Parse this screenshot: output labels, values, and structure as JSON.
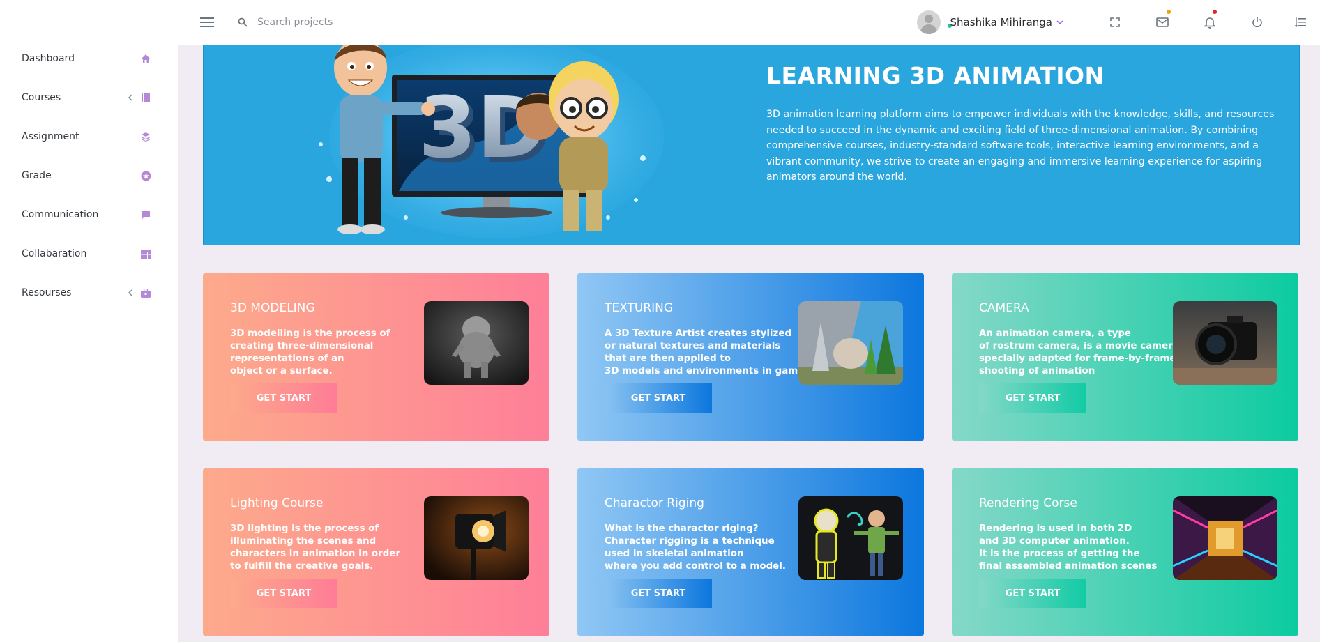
{
  "header": {
    "search_placeholder": "Search projects",
    "user_name": "Shashika Mihiranga",
    "icons": [
      "menu-icon",
      "search-icon",
      "fullscreen-icon",
      "mail-icon",
      "bell-icon",
      "power-icon",
      "list-icon"
    ],
    "mail_dot_color": "#f0a500",
    "bell_dot_color": "#e02424",
    "online_dot_color": "#1bc5a0"
  },
  "sidebar": {
    "items": [
      {
        "label": "Dashboard",
        "icon": "home-icon",
        "has_submenu": false
      },
      {
        "label": "Courses",
        "icon": "book-icon",
        "has_submenu": true
      },
      {
        "label": "Assignment",
        "icon": "layers-icon",
        "has_submenu": false
      },
      {
        "label": "Grade",
        "icon": "star-icon",
        "has_submenu": false
      },
      {
        "label": "Communication",
        "icon": "chat-icon",
        "has_submenu": false
      },
      {
        "label": "Collabaration",
        "icon": "table-icon",
        "has_submenu": false
      },
      {
        "label": "Resourses",
        "icon": "briefcase-icon",
        "has_submenu": true
      }
    ],
    "icon_color": "#b66dff"
  },
  "hero": {
    "title": "LEARNING 3D ANIMATION",
    "description": "3D animation learning platform aims to empower individuals with the knowledge, skills, and resources needed to succeed in the dynamic and exciting field of three-dimensional animation. By combining comprehensive courses, industry-standard software tools, interactive learning environments, and a vibrant community, we strive to create an engaging and immersive learning experience for aspiring animators around the world.",
    "art_text": "3D",
    "background": "#2aa6df"
  },
  "cards": [
    {
      "title": "3D MODELING",
      "desc": "3D modelling is the process of\ncreating three-dimensional\nrepresentations of an\nobject or a surface.",
      "button": "GET START",
      "theme": "pink",
      "image": "sculpture-image"
    },
    {
      "title": "TEXTURING",
      "desc": "A 3D Texture Artist creates stylized\nor natural textures and materials\nthat are then applied to\n3D models and environments in games",
      "button": "GET START",
      "theme": "blue",
      "image": "texture-scene-image"
    },
    {
      "title": "CAMERA",
      "desc": "An animation camera, a type\nof rostrum camera, is a movie camera\nspecially adapted for frame-by-frame\nshooting of animation",
      "button": "GET START",
      "theme": "green",
      "image": "camera-image"
    },
    {
      "title": "Lighting Course",
      "desc": "3D lighting is the process of\nilluminating the scenes and\ncharacters in animation in order\nto fulfill the creative goals.",
      "button": "GET START",
      "theme": "pink",
      "image": "spotlight-image"
    },
    {
      "title": "Charactor Riging",
      "desc": "What is the charactor riging?\nCharacter rigging is a technique\nused in skeletal animation\nwhere you add control to a model.",
      "button": "GET START",
      "theme": "blue",
      "image": "rigging-image"
    },
    {
      "title": "Rendering Corse",
      "desc": "Rendering is used in both 2D\nand 3D computer animation.\nIt is the process of getting the\nfinal assembled animation scenes",
      "button": "GET START",
      "theme": "green",
      "image": "render-corridor-image"
    }
  ]
}
